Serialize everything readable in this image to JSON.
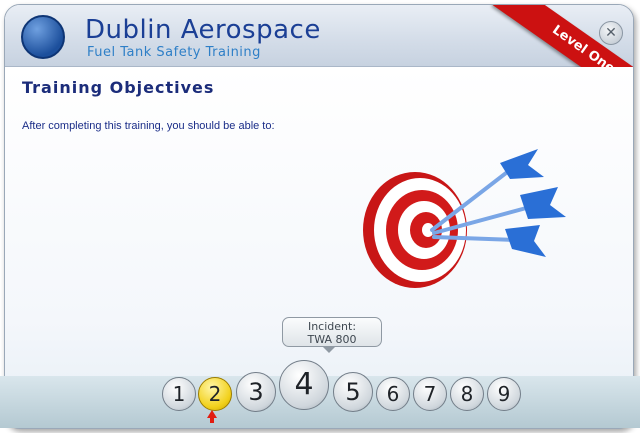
{
  "header": {
    "brand_title": "Dublin Aerospace",
    "brand_subtitle": "Fuel Tank Safety Training",
    "ribbon_label": "Level One",
    "close_icon": "close-icon"
  },
  "main": {
    "title": "Training Objectives",
    "intro": "After completing this training, you should be able to:"
  },
  "tooltip": {
    "line1": "Incident:",
    "line2": "TWA 800"
  },
  "navigation": {
    "buttons": [
      "1",
      "2",
      "3",
      "4",
      "5",
      "6",
      "7",
      "8",
      "9"
    ],
    "current": "2",
    "hovered": "4"
  },
  "colors": {
    "brand_blue": "#1b3f95",
    "ribbon_red": "#cc1111",
    "active_yellow": "#f2d11c",
    "target_red": "#d11a1a",
    "dart_blue": "#2a6fd6"
  }
}
